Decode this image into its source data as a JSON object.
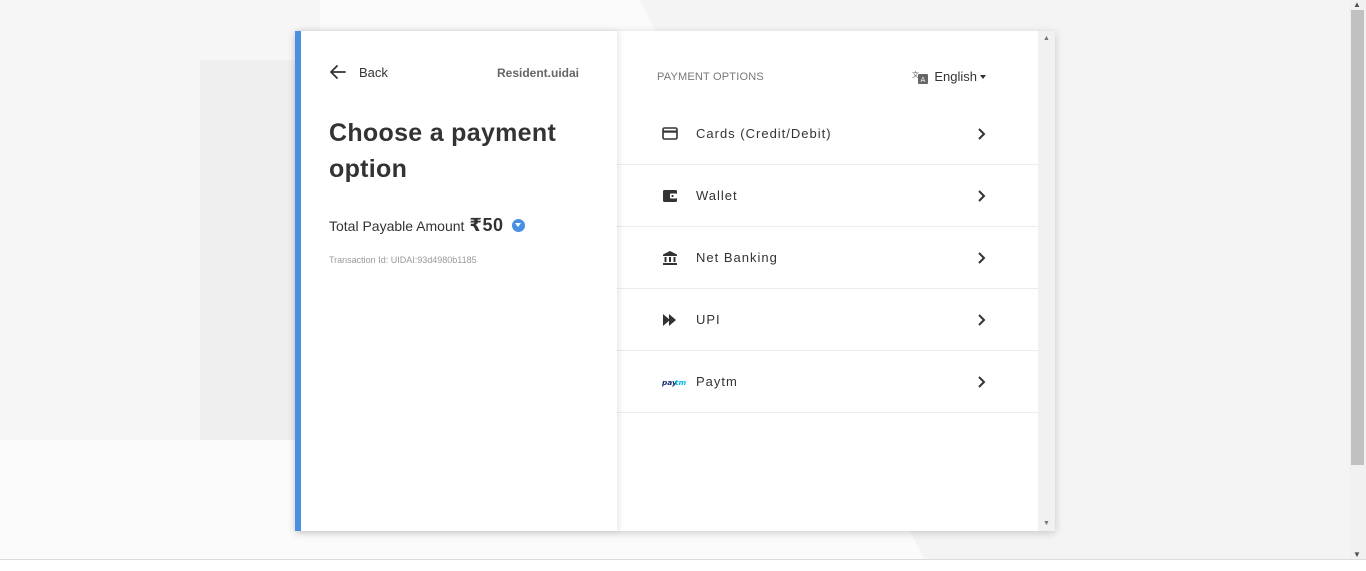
{
  "header": {
    "back_label": "Back",
    "merchant": "Resident.uidai"
  },
  "main": {
    "title": "Choose a payment option",
    "amount_label": "Total Payable Amount",
    "amount_value": "₹50",
    "transaction": "Transaction Id: UIDAI:93d4980b1185"
  },
  "payment": {
    "header": "PAYMENT OPTIONS",
    "language": "English",
    "options": [
      {
        "label": "Cards (Credit/Debit)",
        "icon": "card-icon"
      },
      {
        "label": "Wallet",
        "icon": "wallet-icon"
      },
      {
        "label": "Net Banking",
        "icon": "bank-icon"
      },
      {
        "label": "UPI",
        "icon": "upi-icon"
      },
      {
        "label": "Paytm",
        "icon": "paytm-logo"
      }
    ]
  },
  "colors": {
    "accent": "#4a90e2",
    "text": "#333333",
    "muted": "#999999"
  }
}
